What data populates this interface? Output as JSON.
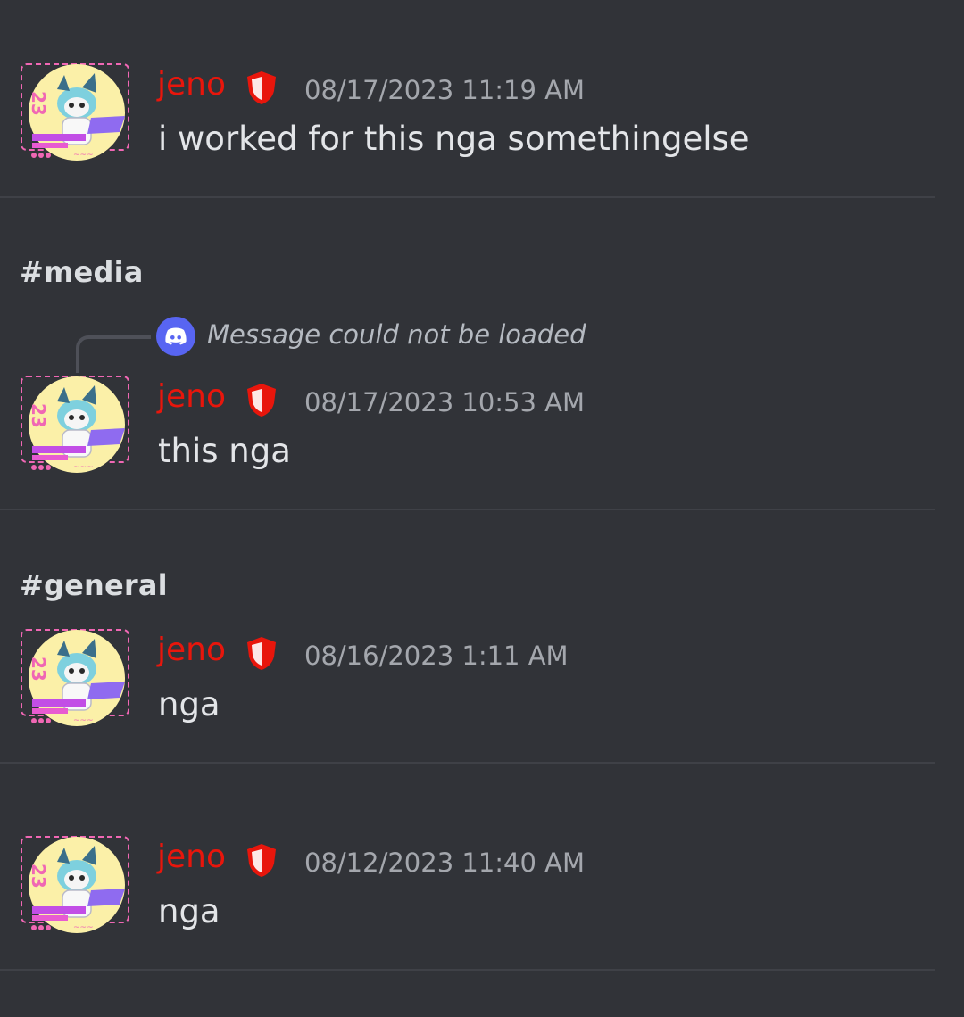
{
  "channels": {
    "media": "#media",
    "general": "#general"
  },
  "reply": {
    "text": "Message could not be loaded",
    "icon": "discord-logo-icon"
  },
  "messages": [
    {
      "author": "jeno",
      "badge": "shield-icon",
      "timestamp": "08/17/2023 11:19 AM",
      "content": "i worked for this nga somethingelse"
    },
    {
      "author": "jeno",
      "badge": "shield-icon",
      "timestamp": "08/17/2023 10:53 AM",
      "content": "this nga"
    },
    {
      "author": "jeno",
      "badge": "shield-icon",
      "timestamp": "08/16/2023 1:11 AM",
      "content": "nga"
    },
    {
      "author": "jeno",
      "badge": "shield-icon",
      "timestamp": "08/12/2023 11:40 AM",
      "content": "nga"
    }
  ],
  "colors": {
    "background": "#313338",
    "author": "#e8160c",
    "timestamp": "#a4a7ad",
    "message_text": "#e3e5e8",
    "divider": "#3f4147",
    "discord_blurple": "#5865f2"
  }
}
